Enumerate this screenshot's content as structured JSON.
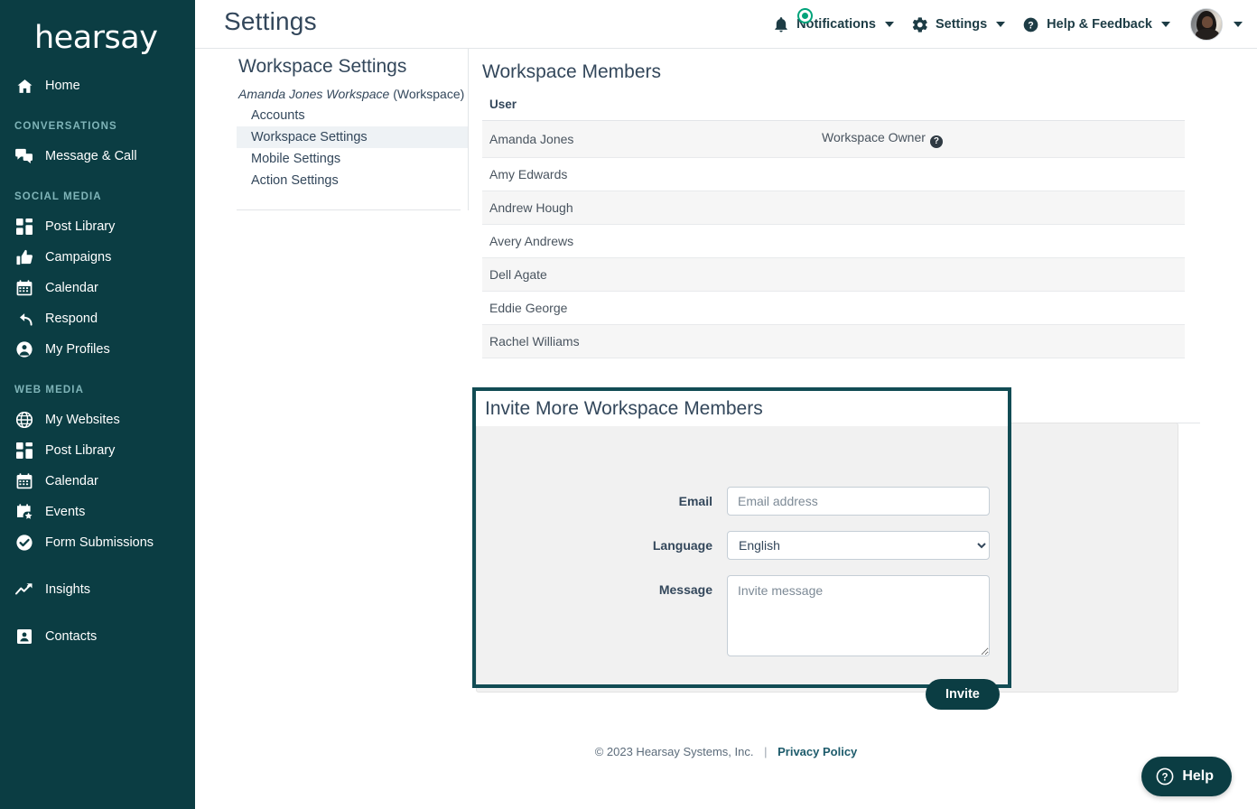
{
  "brand": {
    "logo_text": "hearsay",
    "sidebar_bg": "#0b3d43",
    "accent": "#0b3d43",
    "badge_green": "#00a37a"
  },
  "sidebar": {
    "groups": [
      {
        "label": "",
        "items": [
          {
            "label": "Home",
            "icon": "home-icon"
          }
        ]
      },
      {
        "label": "CONVERSATIONS",
        "items": [
          {
            "label": "Message & Call",
            "icon": "chat-bubbles-icon"
          }
        ]
      },
      {
        "label": "SOCIAL MEDIA",
        "items": [
          {
            "label": "Post Library",
            "icon": "grid-icon"
          },
          {
            "label": "Campaigns",
            "icon": "thumbs-up-icon"
          },
          {
            "label": "Calendar",
            "icon": "calendar-icon"
          },
          {
            "label": "Respond",
            "icon": "reply-arrow-icon"
          },
          {
            "label": "My Profiles",
            "icon": "person-circle-icon"
          }
        ]
      },
      {
        "label": "WEB MEDIA",
        "items": [
          {
            "label": "My Websites",
            "icon": "globe-icon"
          },
          {
            "label": "Post Library",
            "icon": "grid-icon"
          },
          {
            "label": "Calendar",
            "icon": "calendar-icon"
          },
          {
            "label": "Events",
            "icon": "calendar-star-icon"
          },
          {
            "label": "Form Submissions",
            "icon": "check-circle-icon"
          }
        ]
      },
      {
        "label": "",
        "items": [
          {
            "label": "Insights",
            "icon": "trend-up-icon"
          }
        ]
      },
      {
        "label": "",
        "items": [
          {
            "label": "Contacts",
            "icon": "contact-card-icon"
          }
        ]
      }
    ]
  },
  "header": {
    "title": "Settings",
    "notifications_label": "Notifications",
    "settings_label": "Settings",
    "help_feedback_label": "Help & Feedback",
    "notification_badge": true
  },
  "settings_panel": {
    "title": "Workspace Settings",
    "workspace_name": "Amanda Jones Workspace",
    "workspace_suffix": "(Workspace)",
    "nav": [
      {
        "label": "Accounts",
        "active": false
      },
      {
        "label": "Workspace Settings",
        "active": true
      },
      {
        "label": "Mobile Settings",
        "active": false
      },
      {
        "label": "Action Settings",
        "active": false
      }
    ]
  },
  "members": {
    "title": "Workspace Members",
    "columns": [
      "User",
      ""
    ],
    "rows": [
      {
        "user": "Amanda Jones",
        "role": "Workspace Owner",
        "has_help": true
      },
      {
        "user": "Amy Edwards",
        "role": "",
        "has_help": false
      },
      {
        "user": "Andrew Hough",
        "role": "",
        "has_help": false
      },
      {
        "user": "Avery Andrews",
        "role": "",
        "has_help": false
      },
      {
        "user": "Dell Agate",
        "role": "",
        "has_help": false
      },
      {
        "user": "Eddie George",
        "role": "",
        "has_help": false
      },
      {
        "user": "Rachel Williams",
        "role": "",
        "has_help": false
      }
    ]
  },
  "invite": {
    "title": "Invite More Workspace Members",
    "email_label": "Email",
    "email_value": "",
    "email_placeholder": "Email address",
    "language_label": "Language",
    "language_value": "English",
    "language_options": [
      "English"
    ],
    "message_label": "Message",
    "message_value": "",
    "message_placeholder": "Invite message",
    "submit_label": "Invite"
  },
  "footer": {
    "copyright": "© 2023 Hearsay Systems, Inc.",
    "separator": "|",
    "privacy_link": "Privacy Policy"
  },
  "help_widget": {
    "label": "Help"
  }
}
